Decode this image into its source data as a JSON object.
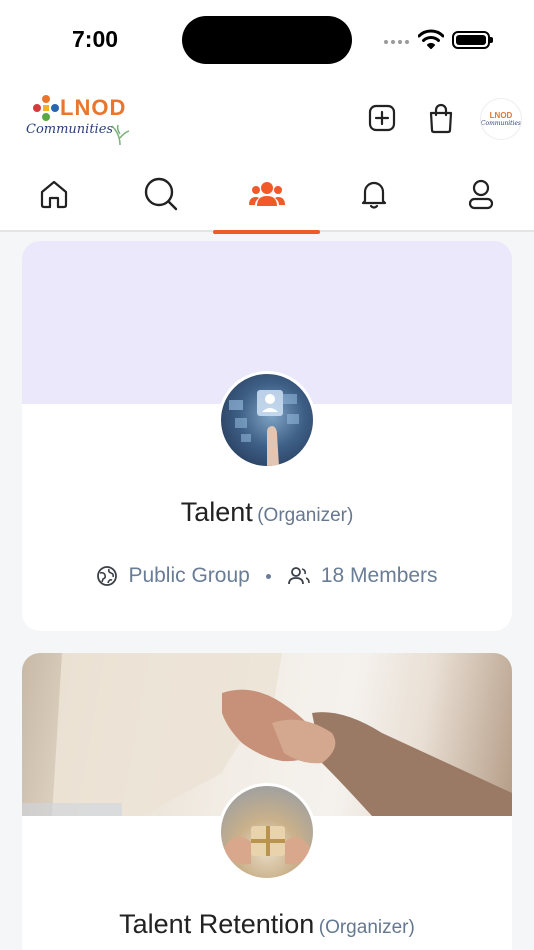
{
  "status_bar": {
    "time": "7:00"
  },
  "header": {
    "logo_text": "LNOD",
    "logo_sub": "Communities",
    "avatar_text_top": "LNOD",
    "avatar_text_bottom": "Communities"
  },
  "tabs": [
    {
      "name": "home",
      "icon": "home-icon"
    },
    {
      "name": "search",
      "icon": "search-icon"
    },
    {
      "name": "groups",
      "icon": "groups-icon",
      "active": true
    },
    {
      "name": "notifications",
      "icon": "bell-icon"
    },
    {
      "name": "profile",
      "icon": "user-icon"
    }
  ],
  "groups": [
    {
      "name": "Talent",
      "role": "(Organizer)",
      "privacy": "Public Group",
      "members": "18 Members",
      "cover_color": "#ebe8fc"
    },
    {
      "name": "Talent Retention",
      "role": "(Organizer)"
    }
  ],
  "colors": {
    "accent": "#f05a28",
    "meta": "#6a7d96"
  }
}
